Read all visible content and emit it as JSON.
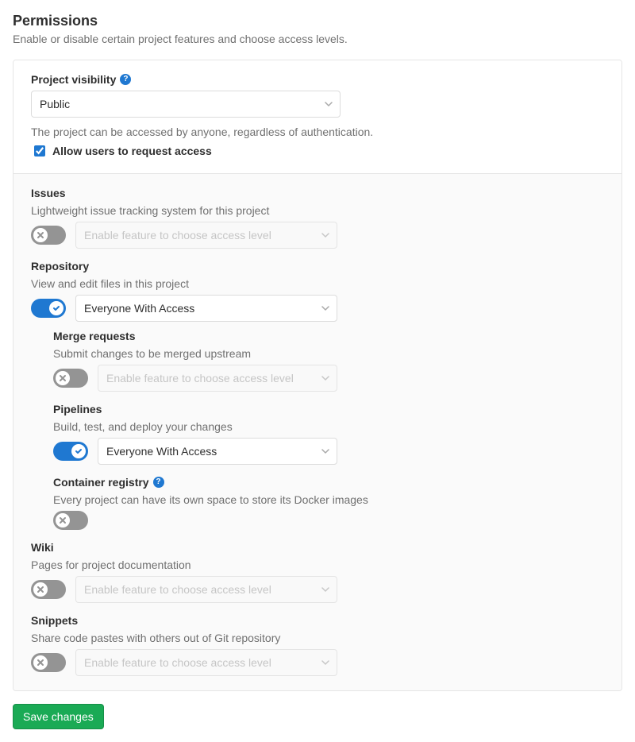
{
  "header": {
    "title": "Permissions",
    "subtitle": "Enable or disable certain project features and choose access levels."
  },
  "visibility": {
    "label": "Project visibility",
    "value": "Public",
    "hint": "The project can be accessed by anyone, regardless of authentication.",
    "request_access_checked": true,
    "request_access_label": "Allow users to request access"
  },
  "placeholders": {
    "disabled_select": "Enable feature to choose access level"
  },
  "access_option": "Everyone With Access",
  "features": {
    "issues": {
      "label": "Issues",
      "desc": "Lightweight issue tracking system for this project",
      "enabled": false
    },
    "repository": {
      "label": "Repository",
      "desc": "View and edit files in this project",
      "enabled": true,
      "sub": {
        "merge_requests": {
          "label": "Merge requests",
          "desc": "Submit changes to be merged upstream",
          "enabled": false
        },
        "pipelines": {
          "label": "Pipelines",
          "desc": "Build, test, and deploy your changes",
          "enabled": true
        },
        "container_registry": {
          "label": "Container registry",
          "desc": "Every project can have its own space to store its Docker images",
          "enabled": false,
          "has_select": false
        }
      }
    },
    "wiki": {
      "label": "Wiki",
      "desc": "Pages for project documentation",
      "enabled": false
    },
    "snippets": {
      "label": "Snippets",
      "desc": "Share code pastes with others out of Git repository",
      "enabled": false
    }
  },
  "actions": {
    "save": "Save changes"
  }
}
